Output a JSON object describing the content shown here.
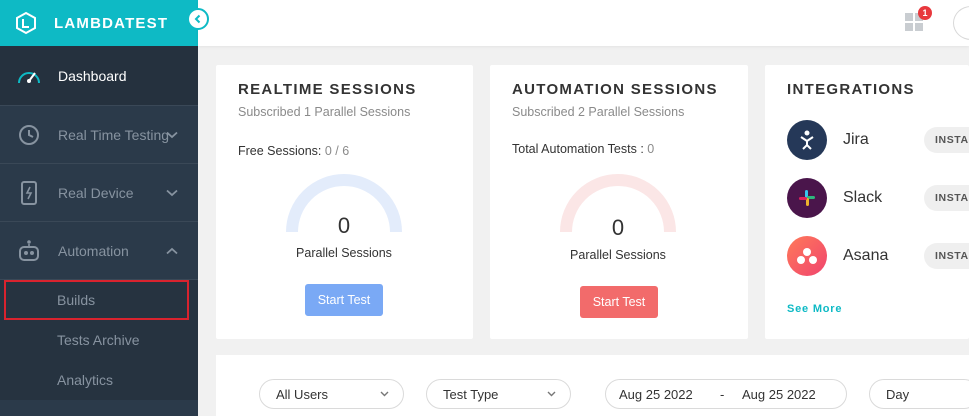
{
  "brand": {
    "name": "LAMBDATEST",
    "accent": "#0ebac5"
  },
  "sidebar": {
    "items": [
      {
        "label": "Dashboard",
        "icon": "speedometer-icon",
        "active": true
      },
      {
        "label": "Real Time Testing",
        "icon": "clock-icon",
        "expandable": true
      },
      {
        "label": "Real Device",
        "icon": "mobile-device-icon",
        "expandable": true
      },
      {
        "label": "Automation",
        "icon": "robot-icon",
        "expanded": true
      }
    ],
    "automation_sub": [
      "Builds",
      "Tests Archive",
      "Analytics"
    ]
  },
  "topbar": {
    "notification_count": "1"
  },
  "realtime": {
    "title": "REALTIME SESSIONS",
    "subtitle": "Subscribed 1 Parallel Sessions",
    "stat_label": "Free Sessions:",
    "stat_value": "0 / 6",
    "gauge_value": "0",
    "gauge_caption": "Parallel Sessions",
    "button": "Start Test",
    "color": "#7aa9f5"
  },
  "automation": {
    "title": "AUTOMATION SESSIONS",
    "subtitle": "Subscribed 2 Parallel Sessions",
    "stat_label": "Total Automation Tests :",
    "stat_value": "0",
    "gauge_value": "0",
    "gauge_caption": "Parallel Sessions",
    "button": "Start Test",
    "color": "#f26b6b"
  },
  "integrations": {
    "title": "INTEGRATIONS",
    "items": [
      {
        "name": "Jira",
        "icon": "jira-icon",
        "action": "INSTA"
      },
      {
        "name": "Slack",
        "icon": "slack-icon",
        "action": "INSTA"
      },
      {
        "name": "Asana",
        "icon": "asana-icon",
        "action": "INSTA"
      }
    ],
    "see_more": "See More"
  },
  "filters": {
    "users": "All Users",
    "test_type": "Test Type",
    "date_from": "Aug 25 2022",
    "date_sep": "-",
    "date_to": "Aug 25 2022",
    "granularity": "Day"
  }
}
